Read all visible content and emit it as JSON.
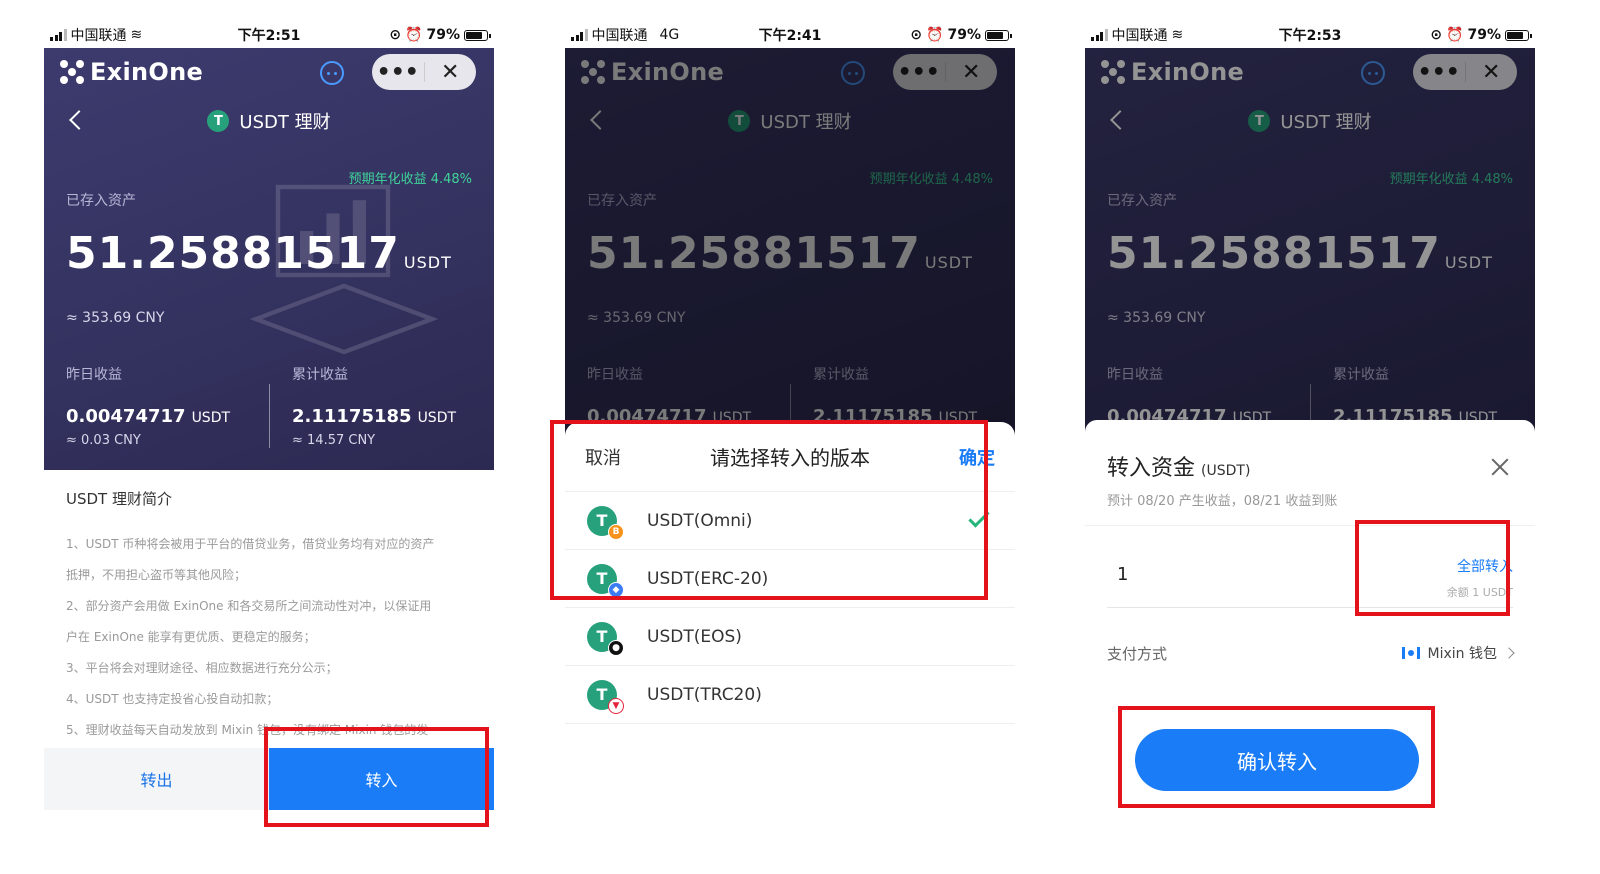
{
  "status_bars": [
    {
      "carrier": "中国联通",
      "network": "",
      "time": "下午2:51",
      "battery": "79%"
    },
    {
      "carrier": "中国联通",
      "network": "4G",
      "time": "下午2:41",
      "battery": "79%"
    },
    {
      "carrier": "中国联通",
      "network": "",
      "time": "下午2:53",
      "battery": "79%"
    }
  ],
  "app": {
    "brand": "ExinOne",
    "more_glyph": "•••",
    "close_glyph": "✕",
    "page_title": "USDT 理财",
    "tether_glyph": "T",
    "apy_text": "预期年化收益 4.48%"
  },
  "holdings": {
    "label": "已存入资产",
    "amount": "51.25881517",
    "unit": "USDT",
    "cny": "≈ 353.69 CNY",
    "yesterday_label": "昨日收益",
    "yesterday_value": "0.00474717",
    "yesterday_cny": "≈ 0.03 CNY",
    "total_label": "累计收益",
    "total_value": "2.11175185",
    "total_cny": "≈ 14.57 CNY"
  },
  "intro": {
    "title": "USDT 理财简介",
    "lines": [
      "1、USDT 币种将会被用于平台的借贷业务，借贷业务均有对应的资产",
      "抵押，不用担心盗币等其他风险；",
      "2、部分资产会用做 ExinOne 和各交易所之间流动性对冲，以保证用",
      "户在 ExinOne 能享有更优质、更稳定的服务；",
      "3、平台将会对理财途径、相应数据进行充分公示；",
      "4、USDT 也支持定投省心投自动扣款；",
      "5、理财收益每天自动发放到 Mixin 钱包，没有绑定 Mixin 钱包的发"
    ]
  },
  "bottom": {
    "transfer_out": "转出",
    "transfer_in": "转入"
  },
  "version_sheet": {
    "cancel": "取消",
    "title": "请选择转入的版本",
    "confirm": "确定",
    "options": [
      {
        "label": "USDT(Omni)",
        "badge": "B",
        "badge_color": "#f7931a",
        "selected": true
      },
      {
        "label": "USDT(ERC-20)",
        "badge": "◆",
        "badge_color": "#3b7cf4",
        "selected": false
      },
      {
        "label": "USDT(EOS)",
        "badge": "●",
        "badge_color": "#111111",
        "selected": false
      },
      {
        "label": "USDT(TRC20)",
        "badge": "▼",
        "badge_color": "#e5243b",
        "selected": false
      }
    ]
  },
  "transfer_card": {
    "title": "转入资金",
    "unit": "(USDT)",
    "subtitle": "预计 08/20 产生收益，08/21 收益到账",
    "amount": "1",
    "all_in": "全部转入",
    "balance": "余额 1 USDT",
    "pay_label": "支付方式",
    "pay_value": "Mixin 钱包",
    "confirm": "确认转入"
  },
  "colors": {
    "accent": "#1a7cf6",
    "hero_bg": "#36345f",
    "highlight": "#e3121b",
    "apy": "#3fd39a",
    "tether": "#26a17b"
  }
}
